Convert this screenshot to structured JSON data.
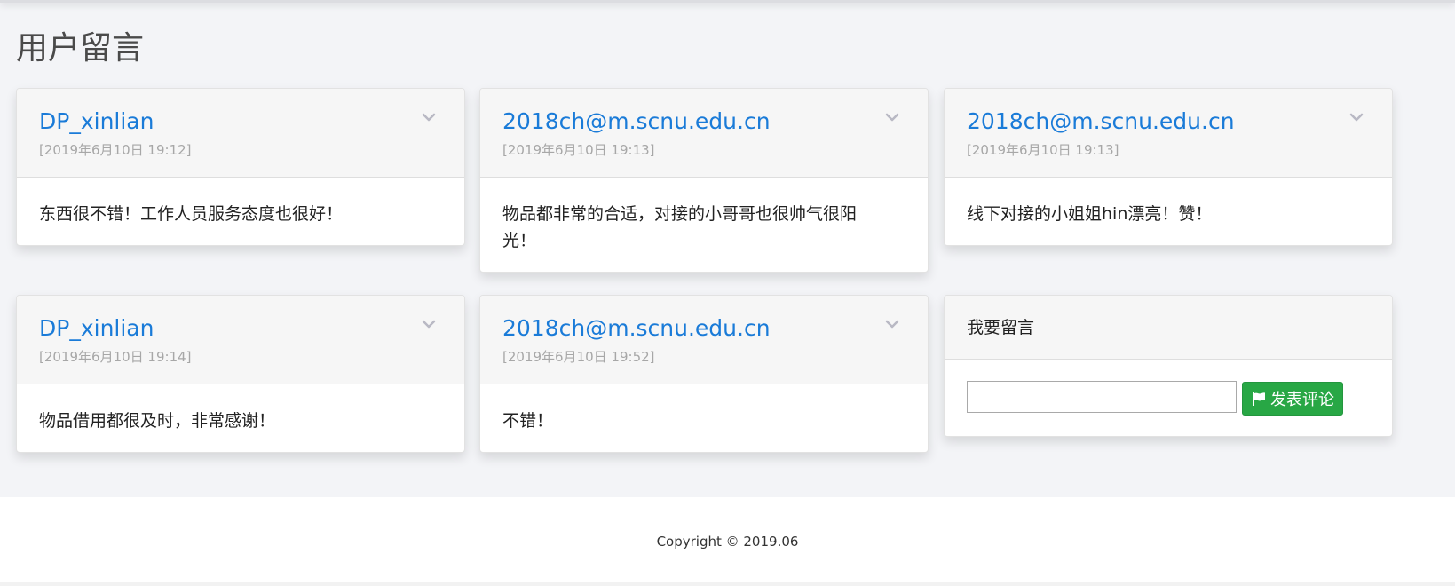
{
  "page": {
    "title": "用户留言"
  },
  "messages": [
    {
      "author": "DP_xinlian",
      "date": "[2019年6月10日 19:12]",
      "content": "东西很不错！工作人员服务态度也很好！"
    },
    {
      "author": "2018ch@m.scnu.edu.cn",
      "date": "[2019年6月10日 19:13]",
      "content": "物品都非常的合适，对接的小哥哥也很帅气很阳光！"
    },
    {
      "author": "2018ch@m.scnu.edu.cn",
      "date": "[2019年6月10日 19:13]",
      "content": "线下对接的小姐姐hin漂亮！赞！"
    },
    {
      "author": "DP_xinlian",
      "date": "[2019年6月10日 19:14]",
      "content": "物品借用都很及时，非常感谢！"
    },
    {
      "author": "2018ch@m.scnu.edu.cn",
      "date": "[2019年6月10日 19:52]",
      "content": "不错！"
    }
  ],
  "comment_form": {
    "title": "我要留言",
    "input_value": "",
    "submit_label": "发表评论",
    "submit_icon": "flag-icon"
  },
  "footer": {
    "copyright": "Copyright © 2019.06"
  },
  "colors": {
    "author_link": "#1a7bd8",
    "submit_button": "#28a745",
    "page_background": "#f3f4f7"
  }
}
